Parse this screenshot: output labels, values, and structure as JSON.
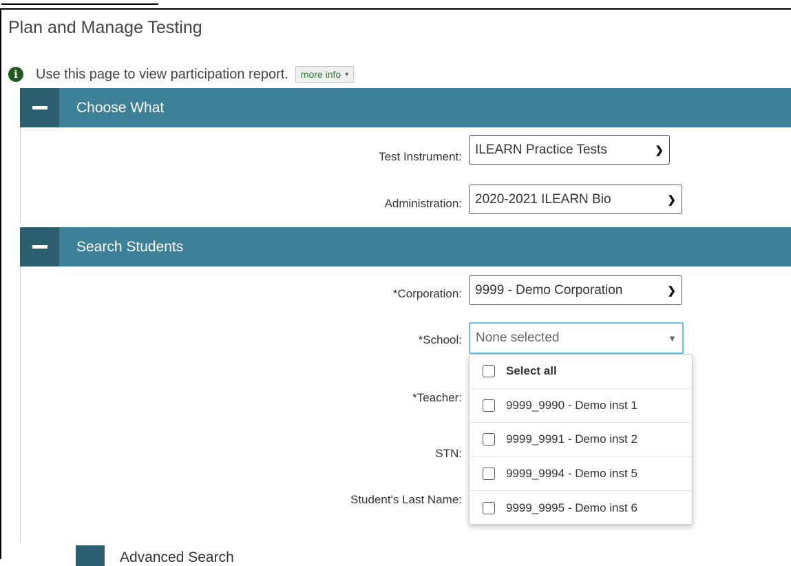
{
  "page": {
    "title": "Plan and Manage Testing"
  },
  "info": {
    "text": "Use this page to view participation report.",
    "more_info_label": "more info"
  },
  "sections": {
    "choose_what": {
      "label": "Choose What"
    },
    "search_students": {
      "label": "Search Students"
    }
  },
  "choose_what": {
    "test_instrument": {
      "label": "Test Instrument:",
      "value": "ILEARN Practice Tests"
    },
    "administration": {
      "label": "Administration:",
      "value": "2020-2021 ILEARN Bio"
    }
  },
  "search": {
    "corporation": {
      "label": "*Corporation:",
      "value": "9999 - Demo Corporation"
    },
    "school": {
      "label": "*School:",
      "value": "None selected"
    },
    "teacher": {
      "label": "*Teacher:"
    },
    "stn": {
      "label": "STN:"
    },
    "last_name": {
      "label": "Student's Last Name:"
    },
    "advanced_search": {
      "label": "Advanced Search"
    }
  },
  "school_dropdown": {
    "select_all": "Select all",
    "options": [
      "9999_9990 - Demo inst 1",
      "9999_9991 - Demo inst 2",
      "9999_9994 - Demo inst 5",
      "9999_9995 - Demo inst 6"
    ]
  },
  "colors": {
    "header": "#3d8198",
    "header_toggle": "#2c5f70",
    "focus": "#66c2e8",
    "info_icon": "#1f5a1f"
  }
}
